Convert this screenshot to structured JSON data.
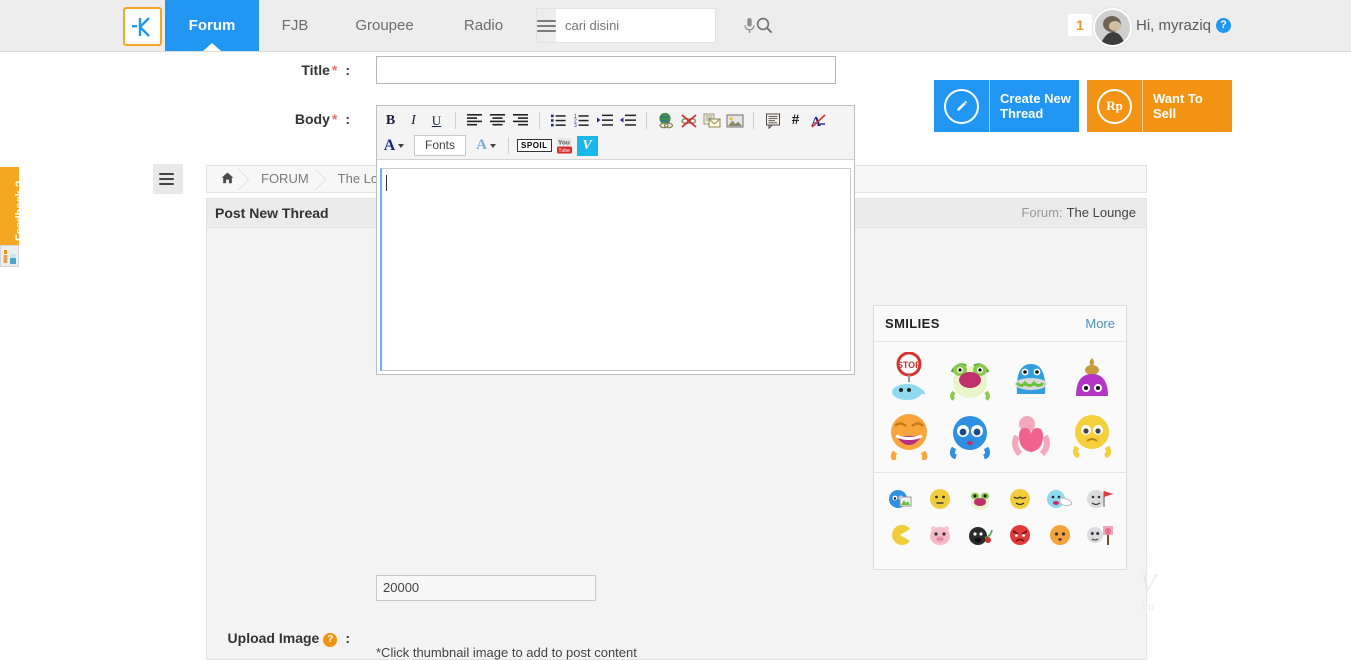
{
  "topnav": {
    "logo_icon": "kaskus-k-logo-icon",
    "tabs": [
      {
        "label": "Forum",
        "active": true
      },
      {
        "label": "FJB",
        "active": false
      },
      {
        "label": "Groupee",
        "active": false
      },
      {
        "label": "Radio",
        "active": false
      }
    ],
    "hamburger_icon": "hamburger-menu-icon",
    "search": {
      "value": "",
      "placeholder": "cari disini"
    },
    "mic_icon": "microphone-icon",
    "search_icon": "search-icon",
    "notification_count": "1",
    "avatar_icon": "user-avatar",
    "greeting": "Hi, myraziq",
    "help_label": "?"
  },
  "actions": {
    "create_thread": {
      "label": "Create New Thread",
      "icon": "pencil-icon",
      "color": "#2196f3"
    },
    "want_to_sell": {
      "label": "Want To Sell",
      "icon": "rupiah-icon",
      "color": "#f39314"
    }
  },
  "feedback": {
    "label": "Feedback ?",
    "color": "#f5a623"
  },
  "sidebar_toggle_icon": "sidebar-toggle-icon",
  "breadcrumb": {
    "home_icon": "home-icon",
    "items": [
      "FORUM",
      "The Lounge"
    ]
  },
  "panel": {
    "title": "Post New Thread",
    "forum_meta_label": "Forum:",
    "forum_meta_value": "The Lounge"
  },
  "form": {
    "title_field": {
      "label": "Title",
      "required": "*",
      "colon": ":",
      "value": "",
      "placeholder": ""
    },
    "body_field": {
      "label": "Body",
      "required": "*",
      "colon": ":",
      "value": ""
    },
    "char_count": "20000",
    "upload": {
      "label": "Upload Image",
      "help": "?",
      "colon": ":",
      "hint": "*Click thumbnail image to add to post content"
    }
  },
  "toolbar": {
    "row1": [
      {
        "name": "bold-icon",
        "glyph": "B",
        "kind": "bold"
      },
      {
        "name": "italic-icon",
        "glyph": "I",
        "kind": "italic"
      },
      {
        "name": "underline-icon",
        "glyph": "U",
        "kind": "underline"
      },
      {
        "name": "sep",
        "kind": "sep"
      },
      {
        "name": "align-left-icon",
        "kind": "align",
        "align": "left"
      },
      {
        "name": "align-center-icon",
        "kind": "align",
        "align": "center"
      },
      {
        "name": "align-right-icon",
        "kind": "align",
        "align": "right"
      },
      {
        "name": "sep",
        "kind": "sep"
      },
      {
        "name": "bullet-list-icon",
        "kind": "list-bullet"
      },
      {
        "name": "numbered-list-icon",
        "kind": "list-number"
      },
      {
        "name": "indent-increase-icon",
        "kind": "indent-in"
      },
      {
        "name": "indent-decrease-icon",
        "kind": "indent-out"
      },
      {
        "name": "sep",
        "kind": "sep"
      },
      {
        "name": "insert-link-icon",
        "kind": "globe"
      },
      {
        "name": "remove-link-icon",
        "kind": "globe-broken"
      },
      {
        "name": "insert-email-icon",
        "kind": "email"
      },
      {
        "name": "insert-image-icon",
        "kind": "image"
      },
      {
        "name": "sep",
        "kind": "sep"
      },
      {
        "name": "quote-icon",
        "kind": "quote"
      },
      {
        "name": "code-icon",
        "glyph": "#",
        "kind": "code"
      },
      {
        "name": "remove-formatting-icon",
        "kind": "remove-format"
      }
    ],
    "row2": [
      {
        "name": "font-color-icon",
        "glyph": "A",
        "kind": "font-color"
      },
      {
        "name": "fonts-dropdown",
        "label": "Fonts",
        "kind": "fonts"
      },
      {
        "name": "font-size-icon",
        "glyph": "A",
        "kind": "font-size"
      },
      {
        "name": "sep",
        "kind": "sep"
      },
      {
        "name": "spoiler-icon",
        "label": "SPOIL",
        "kind": "spoiler"
      },
      {
        "name": "youtube-icon",
        "label": "You",
        "sub": "Tube",
        "kind": "youtube"
      },
      {
        "name": "vimeo-icon",
        "glyph": "V",
        "kind": "vimeo"
      }
    ]
  },
  "smilies": {
    "title": "SMILIES",
    "more_label": "More",
    "big": [
      {
        "name": "smiley-stop-dolphin",
        "colors": [
          "#e03a3a",
          "#6fd3e8"
        ]
      },
      {
        "name": "smiley-green-frog",
        "colors": [
          "#8bc94b",
          "#e9f5c8"
        ]
      },
      {
        "name": "smiley-blue-worm-eater",
        "colors": [
          "#3c9fe0",
          "#8fd14f"
        ]
      },
      {
        "name": "smiley-purple-poop",
        "colors": [
          "#b434c6",
          "#d8a43c"
        ]
      },
      {
        "name": "smiley-orange-laugh",
        "colors": [
          "#f9a53c",
          "#c0389c"
        ]
      },
      {
        "name": "smiley-blue-sad-eyes",
        "colors": [
          "#3c8fe0",
          "#ffffff"
        ]
      },
      {
        "name": "smiley-pink-heart-hug",
        "colors": [
          "#f58fb0",
          "#f25d8e"
        ]
      },
      {
        "name": "smiley-yellow-shy",
        "colors": [
          "#f5cf3c",
          "#ffffff"
        ]
      }
    ],
    "small_row1": [
      {
        "name": "smiley-blue-photo",
        "colors": [
          "#3c8fe0",
          "#9bcf5a"
        ]
      },
      {
        "name": "smiley-yellow-neutral",
        "colors": [
          "#f2cd3b",
          "#f2cd3b"
        ]
      },
      {
        "name": "smiley-green-frog-small",
        "colors": [
          "#8bc94b",
          "#e9f5c8"
        ]
      },
      {
        "name": "smiley-yellow-smug",
        "colors": [
          "#f2cd3b",
          "#f2cd3b"
        ]
      },
      {
        "name": "smiley-cyan-sleep",
        "colors": [
          "#6fd3e8",
          "#ffffff"
        ]
      },
      {
        "name": "smiley-white-flag",
        "colors": [
          "#dcdcdc",
          "#e03a3a"
        ]
      }
    ],
    "small_row2": [
      {
        "name": "smiley-yellow-pacman",
        "colors": [
          "#f2cd3b",
          "#f2cd3b"
        ]
      },
      {
        "name": "smiley-pink-pig",
        "colors": [
          "#f5b9c7",
          "#f5b9c7"
        ]
      },
      {
        "name": "smiley-black-bomb",
        "colors": [
          "#2b2b2b",
          "#4caf50"
        ]
      },
      {
        "name": "smiley-red-angry",
        "colors": [
          "#e03a3a",
          "#e03a3a"
        ]
      },
      {
        "name": "smiley-orange-blank",
        "colors": [
          "#f5a23c",
          "#f5a23c"
        ]
      },
      {
        "name": "smiley-white-rose",
        "colors": [
          "#dcdcdc",
          "#f58fb0"
        ]
      }
    ]
  },
  "watermark": {
    "glyph": "V",
    "sub": "im"
  }
}
